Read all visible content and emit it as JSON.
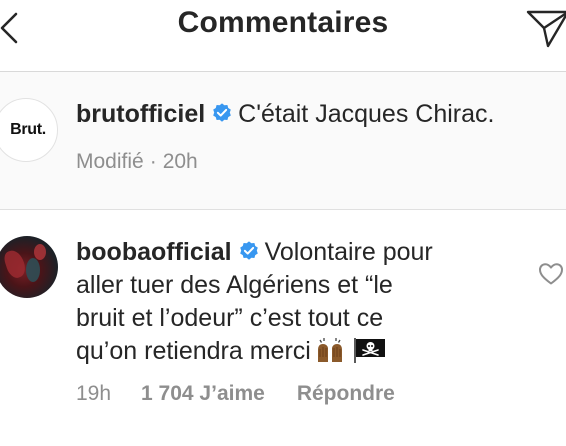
{
  "header": {
    "title": "Commentaires",
    "back_icon": "chevron-left-icon",
    "share_icon": "paper-plane-icon"
  },
  "caption": {
    "avatar_logo_text": "Brut.",
    "username": "brutofficiel",
    "verified": true,
    "text": "C'était Jacques Chirac.",
    "edited_label": "Modifié",
    "separator": "·",
    "time": "20h"
  },
  "comment": {
    "username": "boobaofficial",
    "verified": true,
    "text_lines": [
      "Volontaire pour",
      "aller tuer des Algériens et “le",
      "bruit et l’odeur” c’est tout ce",
      "qu’on retiendra merci"
    ],
    "emojis": [
      "raised-hands-emoji",
      "pirate-flag-emoji"
    ],
    "time": "19h",
    "likes": "1 704 J’aime",
    "reply_label": "Répondre",
    "like_icon": "heart-icon"
  },
  "colors": {
    "text": "#262626",
    "secondary": "#8e8e8e",
    "verified": "#3897f0",
    "caption_background": "#fafafa",
    "divider": "#e0e0e0"
  }
}
